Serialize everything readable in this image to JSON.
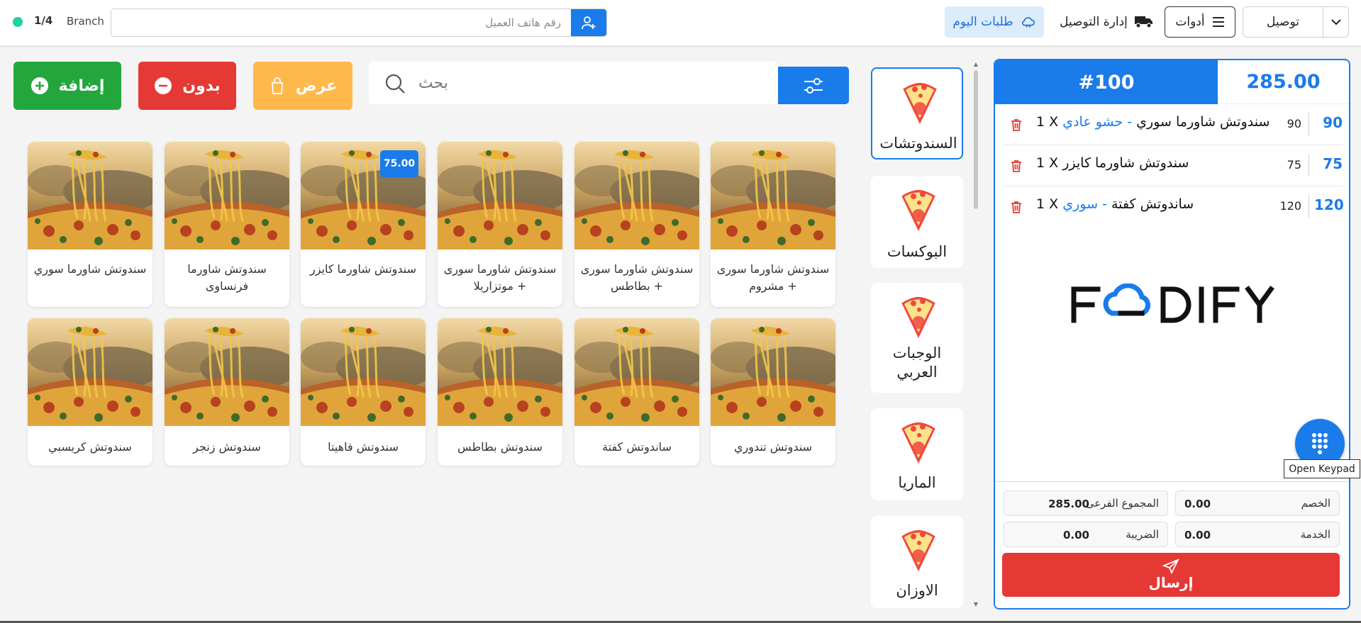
{
  "topbar": {
    "pager": "1/4",
    "branch_label": "Branch",
    "phone_placeholder": "رقم هاتف العميل",
    "today_orders_label": "طلبات اليوم",
    "delivery_management_label": "إدارة التوصيل",
    "tools_label": "أدوات",
    "order_type": "توصيل"
  },
  "actions": {
    "add_label": "إضافة",
    "without_label": "بدون",
    "offer_label": "عرض",
    "search_placeholder": "بحث"
  },
  "products": [
    {
      "name": "سندوتش شاورما سوري",
      "price": ""
    },
    {
      "name": "سندوتش شاورما فرنساوى",
      "price": ""
    },
    {
      "name": "سندوتش شاورما كايزر",
      "price": "75.00"
    },
    {
      "name": "سندوتش شاورما سورى + موتزاريلا",
      "price": ""
    },
    {
      "name": "سندوتش شاورما سورى + بطاطس",
      "price": ""
    },
    {
      "name": "سندوتش شاورما سورى + مشروم",
      "price": ""
    },
    {
      "name": "سندوتش كريسبي",
      "price": ""
    },
    {
      "name": "سندوتش زنجر",
      "price": ""
    },
    {
      "name": "سندوتش فاهيتا",
      "price": ""
    },
    {
      "name": "سندوتش بطاطس",
      "price": ""
    },
    {
      "name": "ساندوتش كفتة",
      "price": ""
    },
    {
      "name": "سندوتش تندوري",
      "price": ""
    }
  ],
  "categories": [
    {
      "label": "السندوتشات",
      "active": true
    },
    {
      "label": "البوكسات",
      "active": false
    },
    {
      "label": "الوجبات العربي",
      "active": false
    },
    {
      "label": "الماريا",
      "active": false
    },
    {
      "label": "الاوزان",
      "active": false
    }
  ],
  "cart": {
    "order_number": "#100",
    "total": "285.00",
    "lines": [
      {
        "qty": "1 X",
        "name": "سندوتش شاورما سوري",
        "option": "حشو عادي",
        "unit_price": "90",
        "line_total": "90"
      },
      {
        "qty": "1 X",
        "name": "سندوتش شاورما كايزر",
        "option": "",
        "unit_price": "75",
        "line_total": "75"
      },
      {
        "qty": "1 X",
        "name": "ساندوتش كفتة",
        "option": "سوري",
        "unit_price": "120",
        "line_total": "120"
      }
    ],
    "brand": "FOODIFY",
    "keypad_tooltip": "Open Keypad",
    "summary": {
      "subtotal_label": "المجموع الفرعى",
      "subtotal_value": "285.00",
      "discount_label": "الخصم",
      "discount_value": "0.00",
      "tax_label": "الضريبة",
      "tax_value": "0.00",
      "service_label": "الخدمة",
      "service_value": "0.00"
    },
    "send_label": "إرسال"
  },
  "colors": {
    "primary": "#1a7bea",
    "add": "#23a73c",
    "remove": "#e53935",
    "offer": "#ffb84c",
    "status": "#1fd1a3"
  }
}
